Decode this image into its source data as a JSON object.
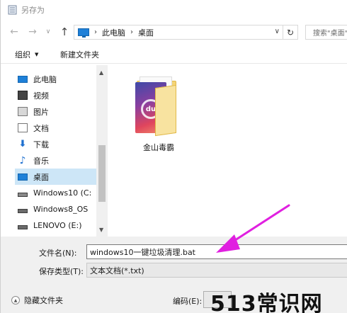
{
  "window": {
    "title": "另存为"
  },
  "address": {
    "crumbs": [
      "此电脑",
      "桌面"
    ],
    "search_placeholder": "搜索\"桌面\""
  },
  "toolbar": {
    "organize_label": "组织",
    "new_folder_label": "新建文件夹"
  },
  "sidebar": {
    "items": [
      {
        "label": "此电脑",
        "icon": "pc-icon"
      },
      {
        "label": "视频",
        "icon": "video-icon"
      },
      {
        "label": "图片",
        "icon": "picture-icon"
      },
      {
        "label": "文档",
        "icon": "document-icon"
      },
      {
        "label": "下载",
        "icon": "download-icon"
      },
      {
        "label": "音乐",
        "icon": "music-icon"
      },
      {
        "label": "桌面",
        "icon": "desktop-icon",
        "selected": true
      },
      {
        "label": "Windows10 (C:",
        "icon": "drive-icon"
      },
      {
        "label": "Windows8_OS",
        "icon": "drive-icon"
      },
      {
        "label": "LENOVO (E:)",
        "icon": "drive-icon"
      }
    ]
  },
  "content": {
    "items": [
      {
        "label": "金山毒霸",
        "icon": "folder-icon"
      }
    ]
  },
  "save": {
    "filename_label": "文件名(N):",
    "filename_value": "windows10一键垃圾清理.bat",
    "filetype_label": "保存类型(T):",
    "filetype_value": "文本文档(*.txt)",
    "hide_folders_label": "隐藏文件夹",
    "encoding_label": "编码(E):"
  },
  "watermark": "513常识网",
  "colors": {
    "selection": "#cde6f7",
    "accent": "#1e80d8",
    "annotation_arrow": "#e020e0"
  }
}
